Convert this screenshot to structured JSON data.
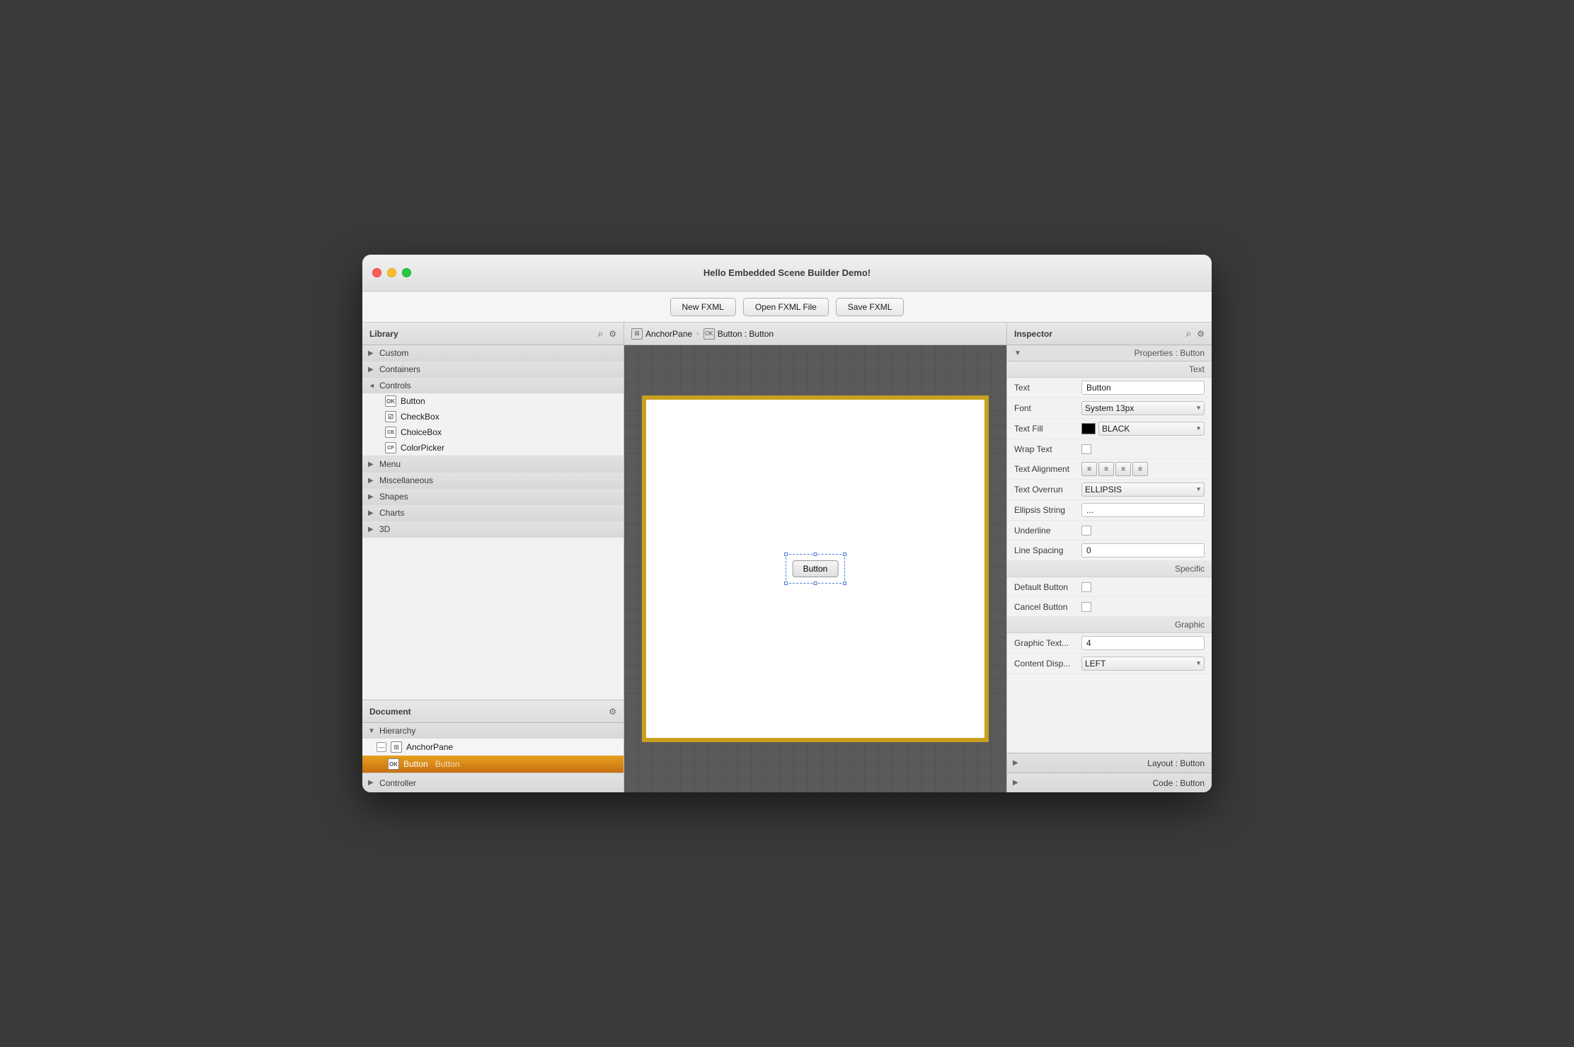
{
  "window": {
    "title": "Hello Embedded Scene Builder Demo!"
  },
  "toolbar": {
    "new_fxml_label": "New FXML",
    "open_fxml_label": "Open FXML File",
    "save_fxml_label": "Save FXML"
  },
  "library": {
    "title": "Library",
    "sections": [
      {
        "id": "custom",
        "label": "Custom",
        "expanded": false
      },
      {
        "id": "containers",
        "label": "Containers",
        "expanded": false
      },
      {
        "id": "controls",
        "label": "Controls",
        "expanded": true
      },
      {
        "id": "menu",
        "label": "Menu",
        "expanded": false
      },
      {
        "id": "miscellaneous",
        "label": "Miscellaneous",
        "expanded": false
      },
      {
        "id": "shapes",
        "label": "Shapes",
        "expanded": false
      },
      {
        "id": "charts",
        "label": "Charts",
        "expanded": false
      },
      {
        "id": "3d",
        "label": "3D",
        "expanded": false
      }
    ],
    "controls_items": [
      {
        "label": "Button",
        "icon": "OK"
      },
      {
        "label": "CheckBox",
        "icon": "☑"
      },
      {
        "label": "ChoiceBox",
        "icon": "CB"
      },
      {
        "label": "ColorPicker",
        "icon": "CP"
      }
    ]
  },
  "document": {
    "title": "Document",
    "hierarchy_label": "Hierarchy",
    "controller_label": "Controller"
  },
  "hierarchy": {
    "anchor_pane_label": "AnchorPane",
    "button_label": "Button",
    "button_class": "Button"
  },
  "breadcrumb": {
    "anchor_pane": "AnchorPane",
    "button_label": "Button : Button"
  },
  "canvas": {
    "button_text": "Button"
  },
  "inspector": {
    "title": "Inspector",
    "section_label": "Properties : Button",
    "text_section": "Text",
    "specific_section": "Specific",
    "graphic_section": "Graphic",
    "layout_section": "Layout : Button",
    "code_section": "Code : Button",
    "fields": {
      "text_label": "Text",
      "text_value": "Button",
      "font_label": "Font",
      "font_value": "System 13px",
      "text_fill_label": "Text Fill",
      "text_fill_value": "BLACK",
      "wrap_text_label": "Wrap Text",
      "text_alignment_label": "Text Alignment",
      "text_overrun_label": "Text Overrun",
      "text_overrun_value": "ELLIPSIS",
      "ellipsis_string_label": "Ellipsis String",
      "ellipsis_string_value": "...",
      "underline_label": "Underline",
      "line_spacing_label": "Line Spacing",
      "line_spacing_value": "0",
      "default_button_label": "Default Button",
      "cancel_button_label": "Cancel Button",
      "graphic_text_label": "Graphic Text...",
      "graphic_text_value": "4",
      "content_disp_label": "Content Disp...",
      "content_disp_value": "LEFT"
    }
  }
}
